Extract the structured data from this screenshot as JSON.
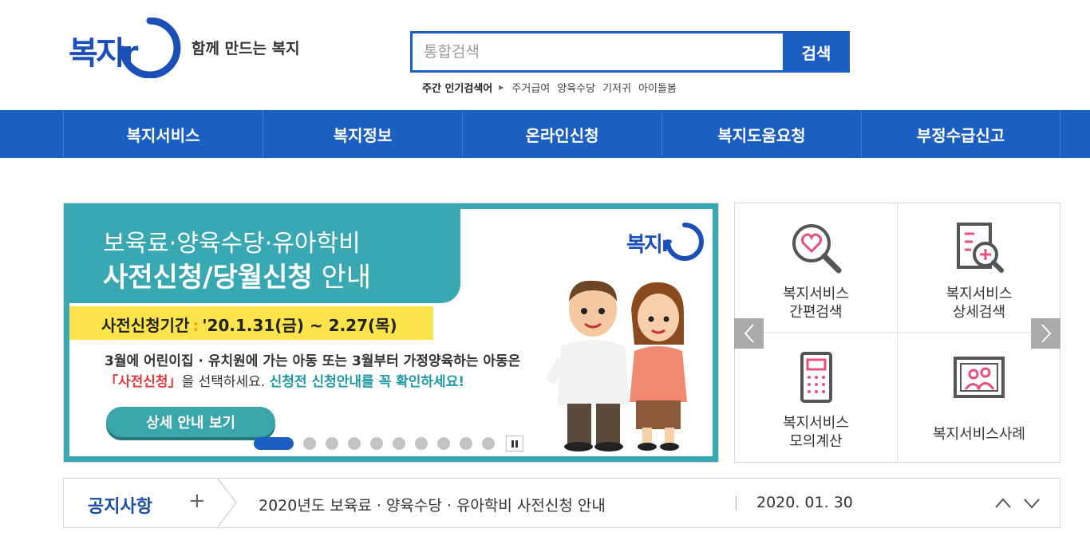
{
  "header": {
    "logo_text": "복지r",
    "slogan": "함께 만드는 복지",
    "search": {
      "placeholder": "통합검색",
      "button_label": "검색"
    },
    "popular": {
      "label": "주간 인기검색어",
      "keywords": [
        "주거급여",
        "양육수당",
        "기저귀",
        "아이돌봄"
      ]
    }
  },
  "nav": {
    "items": [
      "복지서비스",
      "복지정보",
      "온라인신청",
      "복지도움요청",
      "부정수급신고"
    ]
  },
  "banner": {
    "title_line1": "보육료·양육수당·유아학비",
    "title_line2_bold": "사전신청/당월신청",
    "title_line2_light": " 안내",
    "logo_text": "복지r",
    "period_label": "사전신청기간",
    "period_value": "'20.1.31(금) ~ 2.27(목)",
    "desc_line1": "3월에 어린이집 · 유치원에 가는 아동 또는 3월부터 가정양육하는 아동은",
    "desc_line2_red": "「사전신청」",
    "desc_line2_mid": "을  선택하세요.  ",
    "desc_line2_teal": "신청전 신청안내를 꼭 확인하세요!",
    "button_label": "상세 안내 보기",
    "slide_count": 10,
    "active_slide": 1
  },
  "quick_menu": {
    "items": [
      {
        "label": "복지서비스\n간편검색",
        "icon": "heart-search-icon"
      },
      {
        "label": "복지서비스\n상세검색",
        "icon": "document-search-icon"
      },
      {
        "label": "복지서비스\n모의계산",
        "icon": "calculator-icon"
      },
      {
        "label": "복지서비스사례",
        "icon": "family-picture-icon"
      }
    ]
  },
  "notice": {
    "label": "공지사항",
    "plus": "+",
    "title": "2020년도 보육료 · 양육수당 · 유아학비 사전신청 안내",
    "date": "2020. 01. 30"
  },
  "colors": {
    "primary": "#1c5fc2",
    "teal": "#38a8b2",
    "yellow": "#fde44a",
    "red": "#e2383c"
  }
}
